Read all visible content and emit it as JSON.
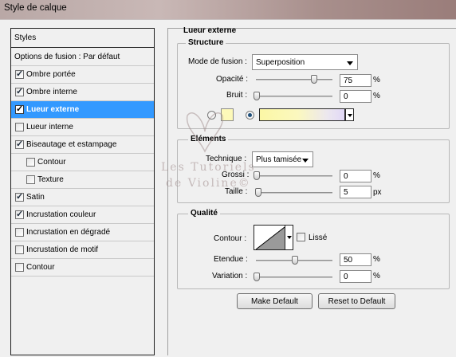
{
  "window": {
    "title": "Style de calque"
  },
  "sidebar": {
    "header": "Styles",
    "items": [
      {
        "label": "Options de fusion : Par défaut",
        "checkbox": false,
        "checked": false,
        "indent": false,
        "selected": false
      },
      {
        "label": "Ombre portée",
        "checkbox": true,
        "checked": true,
        "indent": false,
        "selected": false
      },
      {
        "label": "Ombre interne",
        "checkbox": true,
        "checked": true,
        "indent": false,
        "selected": false
      },
      {
        "label": "Lueur externe",
        "checkbox": true,
        "checked": true,
        "indent": false,
        "selected": true
      },
      {
        "label": "Lueur interne",
        "checkbox": true,
        "checked": false,
        "indent": false,
        "selected": false
      },
      {
        "label": "Biseautage et estampage",
        "checkbox": true,
        "checked": true,
        "indent": false,
        "selected": false
      },
      {
        "label": "Contour",
        "checkbox": true,
        "checked": false,
        "indent": true,
        "selected": false
      },
      {
        "label": "Texture",
        "checkbox": true,
        "checked": false,
        "indent": true,
        "selected": false
      },
      {
        "label": "Satin",
        "checkbox": true,
        "checked": true,
        "indent": false,
        "selected": false
      },
      {
        "label": "Incrustation couleur",
        "checkbox": true,
        "checked": true,
        "indent": false,
        "selected": false
      },
      {
        "label": "Incrustation en dégradé",
        "checkbox": true,
        "checked": false,
        "indent": false,
        "selected": false
      },
      {
        "label": "Incrustation de motif",
        "checkbox": true,
        "checked": false,
        "indent": false,
        "selected": false
      },
      {
        "label": "Contour",
        "checkbox": true,
        "checked": false,
        "indent": false,
        "selected": false
      }
    ]
  },
  "panel": {
    "title": "Lueur externe",
    "structure": {
      "legend": "Structure",
      "blend_mode_label": "Mode de fusion :",
      "blend_mode_value": "Superposition",
      "opacity_label": "Opacité :",
      "opacity_value": "75",
      "opacity_level": 0.75,
      "noise_label": "Bruit :",
      "noise_value": "0",
      "noise_level": 0,
      "percent": "%",
      "color_mode": "gradient",
      "color_swatch": "#fdf9b9"
    },
    "elements": {
      "legend": "Eléments",
      "technique_label": "Technique :",
      "technique_value": "Plus tamisée",
      "spread_label": "Grossi :",
      "spread_value": "0",
      "spread_level": 0,
      "size_label": "Taille :",
      "size_value": "5",
      "size_unit": "px",
      "size_level": 0.02,
      "percent": "%"
    },
    "quality": {
      "legend": "Qualité",
      "contour_label": "Contour :",
      "antialias_label": "Lissé",
      "antialias_checked": false,
      "range_label": "Etendue :",
      "range_value": "50",
      "range_level": 0.5,
      "jitter_label": "Variation :",
      "jitter_value": "0",
      "jitter_level": 0,
      "percent": "%"
    },
    "buttons": {
      "make_default": "Make Default",
      "reset_default": "Reset to Default"
    }
  },
  "watermark": {
    "line1": "Les Tutoriels",
    "line2": "de Violine©"
  },
  "colors": {
    "selection": "#3399ff",
    "title_bar": "#b9a8a6",
    "highlight_text": "#ffffff"
  }
}
